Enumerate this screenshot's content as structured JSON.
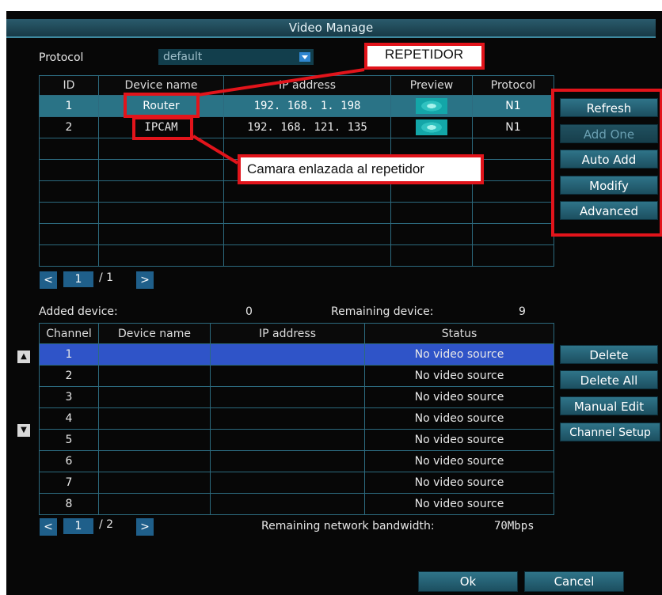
{
  "window": {
    "title": "Video Manage"
  },
  "protocol": {
    "label": "Protocol",
    "value": "default"
  },
  "device_table": {
    "columns": [
      "ID",
      "Device name",
      "IP address",
      "Preview",
      "Protocol"
    ],
    "rows": [
      {
        "id": "1",
        "name": "Router",
        "ip": "192. 168. 1. 198",
        "protocol": "N1"
      },
      {
        "id": "2",
        "name": "IPCAM",
        "ip": "192. 168. 121. 135",
        "protocol": "N1"
      }
    ],
    "page_current": "1",
    "page_total": "/ 1"
  },
  "side_buttons": {
    "refresh": "Refresh",
    "add_one": "Add One",
    "auto_add": "Auto Add",
    "modify": "Modify",
    "advanced": "Advanced"
  },
  "summary": {
    "added_label": "Added device:",
    "added_value": "0",
    "remaining_label": "Remaining device:",
    "remaining_value": "9"
  },
  "channel_table": {
    "columns": [
      "Channel",
      "Device name",
      "IP address",
      "Status"
    ],
    "rows": [
      {
        "channel": "1",
        "status": "No video source"
      },
      {
        "channel": "2",
        "status": "No video source"
      },
      {
        "channel": "3",
        "status": "No video source"
      },
      {
        "channel": "4",
        "status": "No video source"
      },
      {
        "channel": "5",
        "status": "No video source"
      },
      {
        "channel": "6",
        "status": "No video source"
      },
      {
        "channel": "7",
        "status": "No video source"
      },
      {
        "channel": "8",
        "status": "No video source"
      }
    ],
    "page_current": "1",
    "page_total": "/ 2"
  },
  "channel_buttons": {
    "delete": "Delete",
    "delete_all": "Delete All",
    "manual_edit": "Manual Edit",
    "channel_setup": "Channel Setup"
  },
  "bandwidth": {
    "label": "Remaining network bandwidth:",
    "value": "70Mbps"
  },
  "footer": {
    "ok": "Ok",
    "cancel": "Cancel"
  },
  "annotations": {
    "repetidor": "REPETIDOR",
    "camara": "Camara enlazada al repetidor",
    "color": "#e2141b"
  },
  "nav": {
    "prev": "<",
    "next": ">",
    "up": "▲",
    "down": "▼"
  }
}
